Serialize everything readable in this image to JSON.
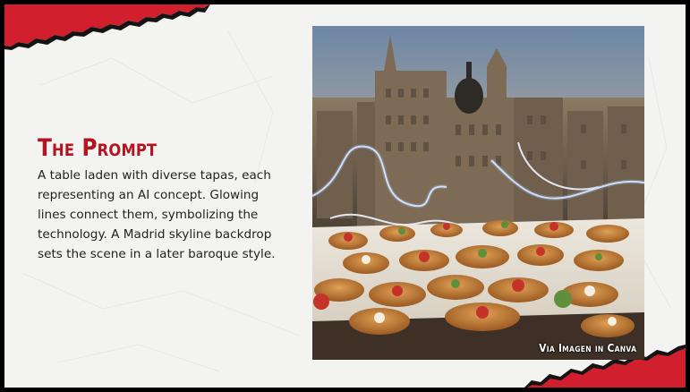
{
  "slide": {
    "heading": "The Prompt",
    "body": "A table laden with diverse tapas, each representing an AI concept. Glowing lines connect them, symbolizing the technology. A Madrid skyline backdrop sets the scene in a later baroque style.",
    "image_caption": "Via Imagen in Canva"
  },
  "colors": {
    "accent_red": "#d11f2e",
    "heading_red": "#b3141f",
    "background": "#f3f3f1",
    "frame": "#000000"
  }
}
